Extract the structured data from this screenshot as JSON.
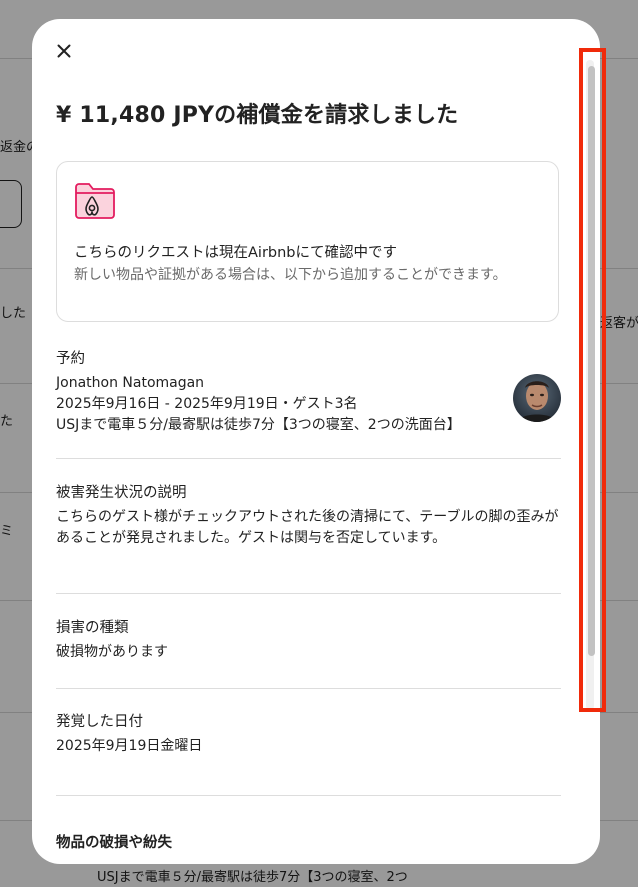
{
  "background": {
    "side_texts": [
      "返金の",
      "した",
      "た",
      "ミ",
      "返客が"
    ],
    "bottom_text": "USJまで電車５分/最寄駅は徒歩7分【3つの寝室、2つ"
  },
  "modal": {
    "close_label": "×",
    "title": "¥ 11,480 JPYの補償金を請求しました",
    "info_card": {
      "heading": "こちらのリクエストは現在Airbnbにて確認中です",
      "subtext": "新しい物品や証拠がある場合は、以下から追加することができます。"
    },
    "reservation": {
      "label": "予約",
      "guest_name": "Jonathon Natomagan",
      "dates": "2025年9月16日 - 2025年9月19日・ゲスト3名",
      "listing": "USJまで電車５分/最寄駅は徒歩7分【3つの寝室、2つの洗面台】"
    },
    "damage_description": {
      "label": "被害発生状況の説明",
      "text": "こちらのゲスト様がチェックアウトされた後の清掃にて、テーブルの脚の歪みがあることが発見されました。ゲストは関与を否定しています。"
    },
    "damage_type": {
      "label": "損害の種類",
      "value": "破損物があります"
    },
    "discovered_date": {
      "label": "発覚した日付",
      "value": "2025年9月19日金曜日"
    },
    "items_section": {
      "label": "物品の破損や紛失"
    }
  },
  "colors": {
    "accent_pink": "#e31c5f",
    "folder_fill": "#fbd3dd",
    "text_primary": "#222222",
    "text_secondary": "#6a6a6a",
    "highlight": "#f02a0a"
  },
  "icons": {
    "close": "close-icon",
    "folder": "airbnb-folder-icon"
  }
}
